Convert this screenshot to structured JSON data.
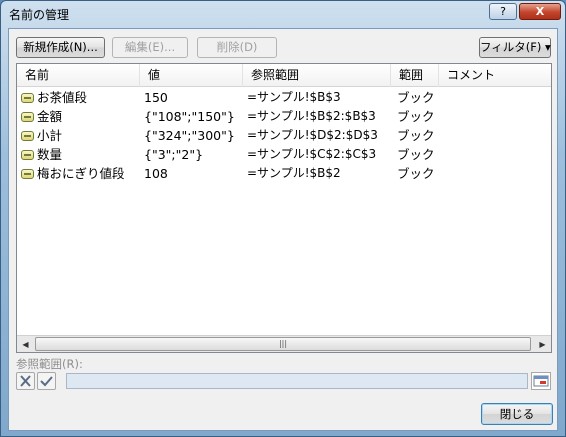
{
  "window": {
    "title": "名前の管理",
    "help_label": "?",
    "close_label": "X"
  },
  "toolbar": {
    "new_label": "新規作成(N)...",
    "edit_label": "編集(E)...",
    "delete_label": "削除(D)",
    "filter_label": "フィルタ(F) ▾"
  },
  "list": {
    "columns": [
      "名前",
      "値",
      "参照範囲",
      "範囲",
      "コメント"
    ],
    "rows": [
      {
        "name": "お茶値段",
        "value": "150",
        "ref": "=サンプル!$B$3",
        "scope": "ブック",
        "comment": ""
      },
      {
        "name": "金額",
        "value": "{\"108\";\"150\"}",
        "ref": "=サンプル!$B$2:$B$3",
        "scope": "ブック",
        "comment": ""
      },
      {
        "name": "小計",
        "value": "{\"324\";\"300\"}",
        "ref": "=サンプル!$D$2:$D$3",
        "scope": "ブック",
        "comment": ""
      },
      {
        "name": "数量",
        "value": "{\"3\";\"2\"}",
        "ref": "=サンプル!$C$2:$C$3",
        "scope": "ブック",
        "comment": ""
      },
      {
        "name": "梅おにぎり値段",
        "value": "108",
        "ref": "=サンプル!$B$2",
        "scope": "ブック",
        "comment": ""
      }
    ]
  },
  "refers_to": {
    "label": "参照範囲(R):",
    "value": ""
  },
  "footer": {
    "close_label": "閉じる"
  }
}
